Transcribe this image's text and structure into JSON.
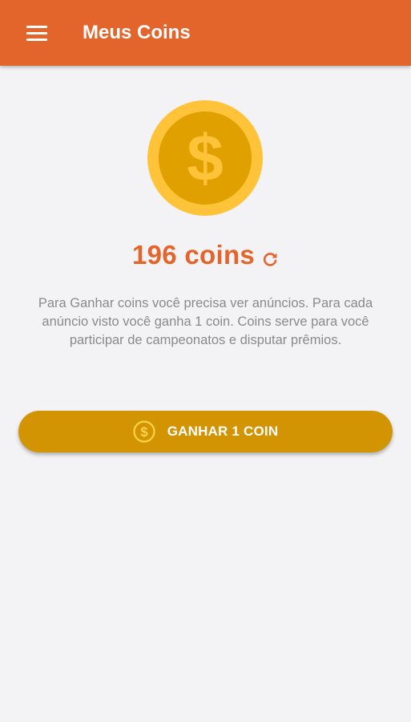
{
  "app_bar": {
    "title": "Meus Coins",
    "menu_icon": "hamburger-menu-icon",
    "background_color": "#e4652c"
  },
  "coin_image": {
    "icon": "dollar-coin-icon",
    "outer_color": "#ffc33a",
    "inner_color": "#e0a000"
  },
  "balance": {
    "text": "196 coins",
    "refresh_icon": "refresh-icon",
    "color": "#e4652c"
  },
  "info": {
    "text": "Para Ganhar coins você precisa ver anúncios. Para cada anúncio visto você ganha 1 coin. Coins serve para você participar de campeonatos e disputar prêmios."
  },
  "earn_button": {
    "label": "GANHAR 1 COIN",
    "icon": "dollar-circle-icon",
    "background_color": "#d29403"
  }
}
